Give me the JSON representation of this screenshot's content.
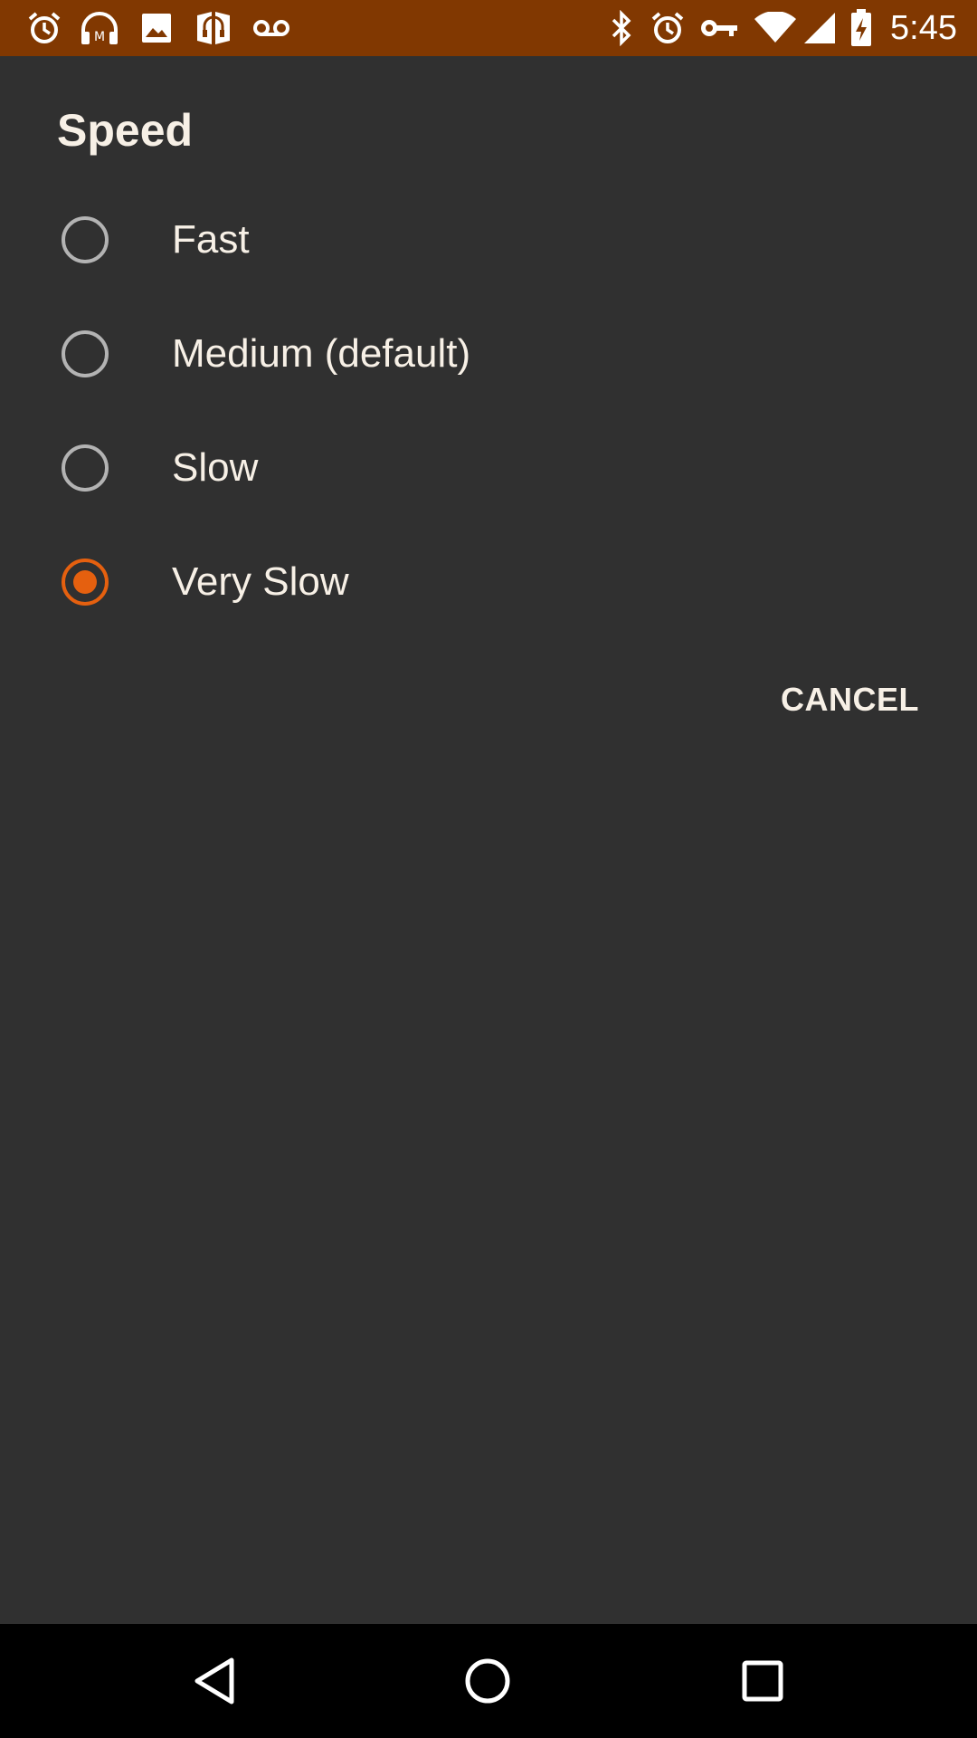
{
  "status_bar": {
    "time": "5:45",
    "background": "#813801",
    "left_icons": [
      "alarm-icon",
      "headphones-icon",
      "image-icon",
      "audiobook-icon",
      "voicemail-icon"
    ],
    "right_icons": [
      "bluetooth-icon",
      "alarm-icon",
      "vpn-key-icon",
      "wifi-icon",
      "cell-signal-icon",
      "battery-charging-icon"
    ]
  },
  "dialog": {
    "title": "Speed",
    "options": [
      {
        "label": "Fast",
        "selected": false
      },
      {
        "label": "Medium (default)",
        "selected": false
      },
      {
        "label": "Slow",
        "selected": false
      },
      {
        "label": "Very Slow",
        "selected": true
      }
    ],
    "cancel_label": "CANCEL",
    "accent_color": "#e5600f"
  },
  "nav_bar": {
    "buttons": [
      "back-icon",
      "home-icon",
      "recents-icon"
    ]
  }
}
